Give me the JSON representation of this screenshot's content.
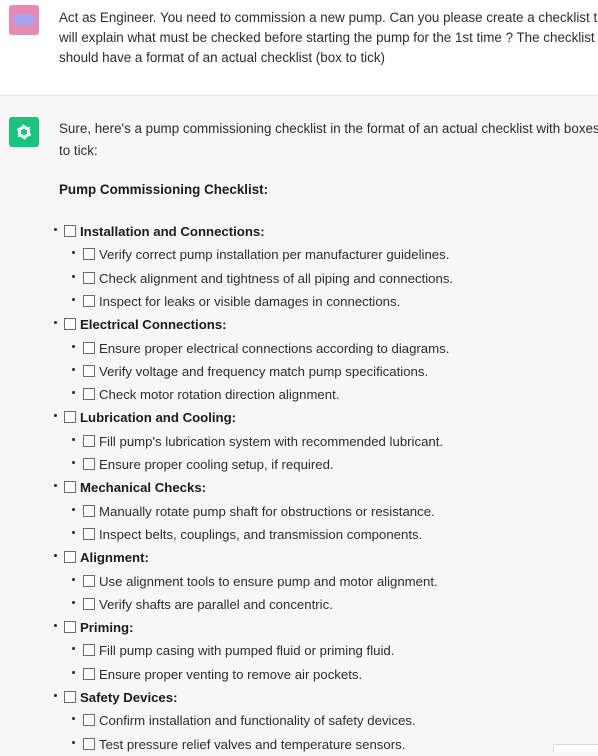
{
  "user_message": {
    "lines": [
      "Act as Engineer. You need to commission a new pump. Can you please create a checklist that",
      "will explain what must be checked before starting the pump for the 1st time ? The checklist",
      "should have a format of an actual checklist (box to tick)"
    ]
  },
  "assistant_message": {
    "intro_lines": [
      "Sure, here's a pump commissioning checklist in the format of an actual checklist with boxes",
      "to tick:"
    ],
    "checklist_title": "Pump Commissioning Checklist:",
    "sections": [
      {
        "title": "Installation and Connections:",
        "items": [
          "Verify correct pump installation per manufacturer guidelines.",
          "Check alignment and tightness of all piping and connections.",
          "Inspect for leaks or visible damages in connections."
        ]
      },
      {
        "title": "Electrical Connections:",
        "items": [
          "Ensure proper electrical connections according to diagrams.",
          "Verify voltage and frequency match pump specifications.",
          "Check motor rotation direction alignment."
        ]
      },
      {
        "title": "Lubrication and Cooling:",
        "items": [
          "Fill pump's lubrication system with recommended lubricant.",
          "Ensure proper cooling setup, if required."
        ]
      },
      {
        "title": "Mechanical Checks:",
        "items": [
          "Manually rotate pump shaft for obstructions or resistance.",
          "Inspect belts, couplings, and transmission components."
        ]
      },
      {
        "title": "Alignment:",
        "items": [
          "Use alignment tools to ensure pump and motor alignment.",
          "Verify shafts are parallel and concentric."
        ]
      },
      {
        "title": "Priming:",
        "items": [
          "Fill pump casing with pumped fluid or priming fluid.",
          "Ensure proper venting to remove air pockets."
        ]
      },
      {
        "title": "Safety Devices:",
        "items": [
          "Confirm installation and functionality of safety devices.",
          "Test pressure relief valves and temperature sensors."
        ]
      }
    ]
  },
  "colors": {
    "user_avatar": "#e58bb3",
    "assistant_avatar": "#19c37d",
    "assistant_background": "#f7f7f8"
  },
  "icons": {
    "user_avatar": "user-avatar-icon",
    "assistant_avatar": "openai-logo-icon"
  }
}
